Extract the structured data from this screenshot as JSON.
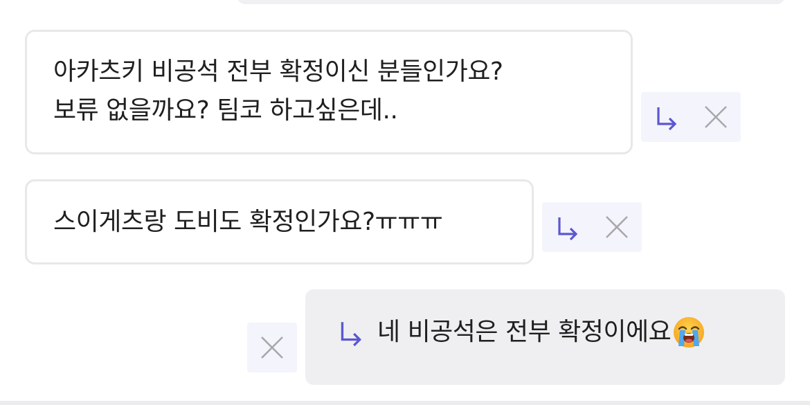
{
  "messages": [
    {
      "lines": [
        "아카츠키 비공석 전부 확정이신 분들인가요?",
        "보류 없을까요? 팀코 하고싶은데.."
      ]
    },
    {
      "text": "스이게츠랑 도비도 확정인가요?ㅠㅠㅠ"
    }
  ],
  "my_reply": {
    "text": "네 비공석은 전부 확정이에요",
    "emoji_icon": "loudly-crying-face-icon"
  },
  "icons": {
    "reply": "reply-arrow-icon",
    "close": "close-icon"
  },
  "colors": {
    "reply_accent": "#5b57d1",
    "close_gray": "#a8a8ac",
    "action_bg": "#f4f4fc",
    "mine_bubble_bg": "#efeff1",
    "bubble_border": "#e8e8ea",
    "text": "#1f1f1f"
  }
}
